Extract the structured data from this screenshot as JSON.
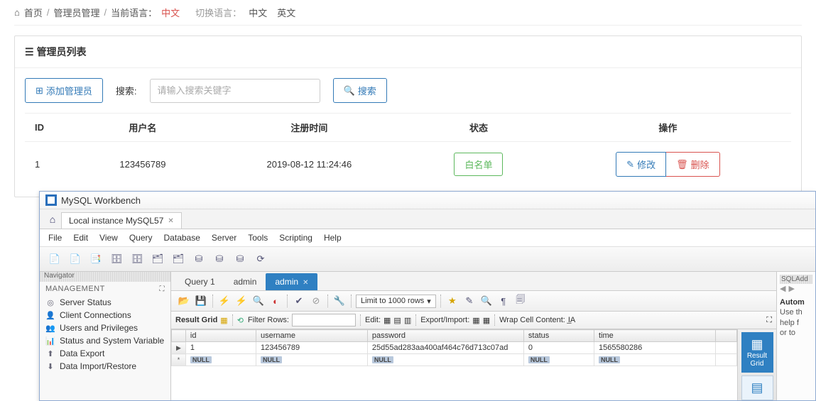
{
  "breadcrumb": {
    "home": "首页",
    "admin_mgmt": "管理员管理",
    "cur_lang_label": "当前语言：",
    "cur_lang_val": "中文",
    "switch_label": "切换语言：",
    "lang_cn": "中文",
    "lang_en": "英文"
  },
  "card": {
    "title": "管理员列表",
    "add_btn": "添加管理员",
    "search_label": "搜索:",
    "search_placeholder": "请输入搜索关键字",
    "search_btn": "搜索"
  },
  "table": {
    "headers": {
      "id": "ID",
      "username": "用户名",
      "reg_time": "注册时间",
      "status": "状态",
      "ops": "操作"
    },
    "row": {
      "id": "1",
      "username": "123456789",
      "reg_time": "2019-08-12 11:24:46",
      "status": "白名单",
      "edit": "修改",
      "del": "删除"
    }
  },
  "workbench": {
    "title": "MySQL Workbench",
    "conn_tab": "Local instance MySQL57",
    "menus": [
      "File",
      "Edit",
      "View",
      "Query",
      "Database",
      "Server",
      "Tools",
      "Scripting",
      "Help"
    ],
    "nav_label": "Navigator",
    "mgmt_title": "MANAGEMENT",
    "mgmt_items": [
      "Server Status",
      "Client Connections",
      "Users and Privileges",
      "Status and System Variable",
      "Data Export",
      "Data Import/Restore"
    ],
    "query_tabs": [
      {
        "label": "Query 1",
        "active": false
      },
      {
        "label": "admin",
        "active": false
      },
      {
        "label": "admin",
        "active": true
      }
    ],
    "limit": "Limit to 1000 rows",
    "result": {
      "label": "Result Grid",
      "filter_label": "Filter Rows:",
      "edit_label": "Edit:",
      "export_label": "Export/Import:",
      "wrap_label": "Wrap Cell Content:"
    },
    "grid": {
      "cols": [
        "id",
        "username",
        "password",
        "status",
        "time"
      ],
      "rows": [
        {
          "id": "1",
          "username": "123456789",
          "password": "25d55ad283aa400af464c76d713c07ad",
          "status": "0",
          "time": "1565580286"
        }
      ],
      "null": "NULL"
    },
    "side_tab": "Result Grid",
    "right_title": "SQLAdd",
    "right_lines": [
      "Autom",
      "Use th",
      "help f",
      "or to"
    ]
  }
}
